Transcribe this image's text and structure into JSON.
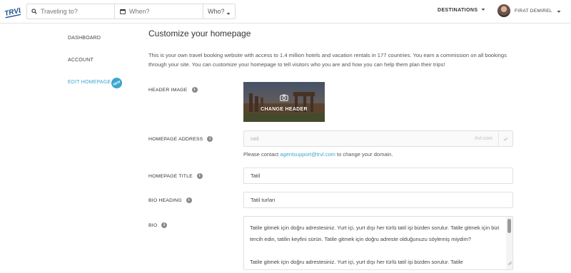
{
  "brand": {
    "logo_text": "TRVL",
    "accent": "#3aa6cf"
  },
  "search": {
    "where_placeholder": "Traveling to?",
    "when_placeholder": "When?",
    "who_label": "Who?"
  },
  "nav": {
    "destinations_label": "DESTINATIONS",
    "user_name": "FIRAT DEMIREL"
  },
  "sidebar": {
    "items": [
      {
        "label": "DASHBOARD"
      },
      {
        "label": "ACCOUNT"
      },
      {
        "label": "EDIT HOMEPAGE",
        "active": true,
        "badge": "NEW"
      }
    ]
  },
  "main": {
    "title": "Customize your homepage",
    "intro": "This is your own travel booking website with access to 1.4 million hotels and vacation rentals in 177 countries. You earn a commission on all bookings through your site. You can customize your homepage to tell visitors who you are and how you can help them plan their trips!",
    "header_image_label": "HEADER IMAGE",
    "change_header_label": "CHANGE HEADER",
    "homepage_address_label": "HOMEPAGE ADDRESS",
    "homepage_address_value": "tatil",
    "homepage_address_suffix": ".trvl.com",
    "contact_prefix": "Please contact ",
    "contact_email": "agentsupport@trvl.com",
    "contact_suffix": " to change your domain.",
    "homepage_title_label": "HOMEPAGE TITLE",
    "homepage_title_value": "Tatil",
    "bio_heading_label": "BIO HEADING",
    "bio_heading_value": "Tatil turları",
    "bio_label": "BIO",
    "bio_value": "Tatile gitmek için doğru adrestesiniz. Yurt içi, yurt dışı her türlü tatil işi bizden sorulur. Tatile gitmek için bizi tercih edin, tatilin keyfini sürün. Tatile gitmek için doğru adreste olduğunuzu söylemiş miydim?\n\nTatile gitmek için doğru adrestesiniz. Yurt içi, yurt dışı her türlü tatil işi bizden sorulur. Tatile"
  }
}
